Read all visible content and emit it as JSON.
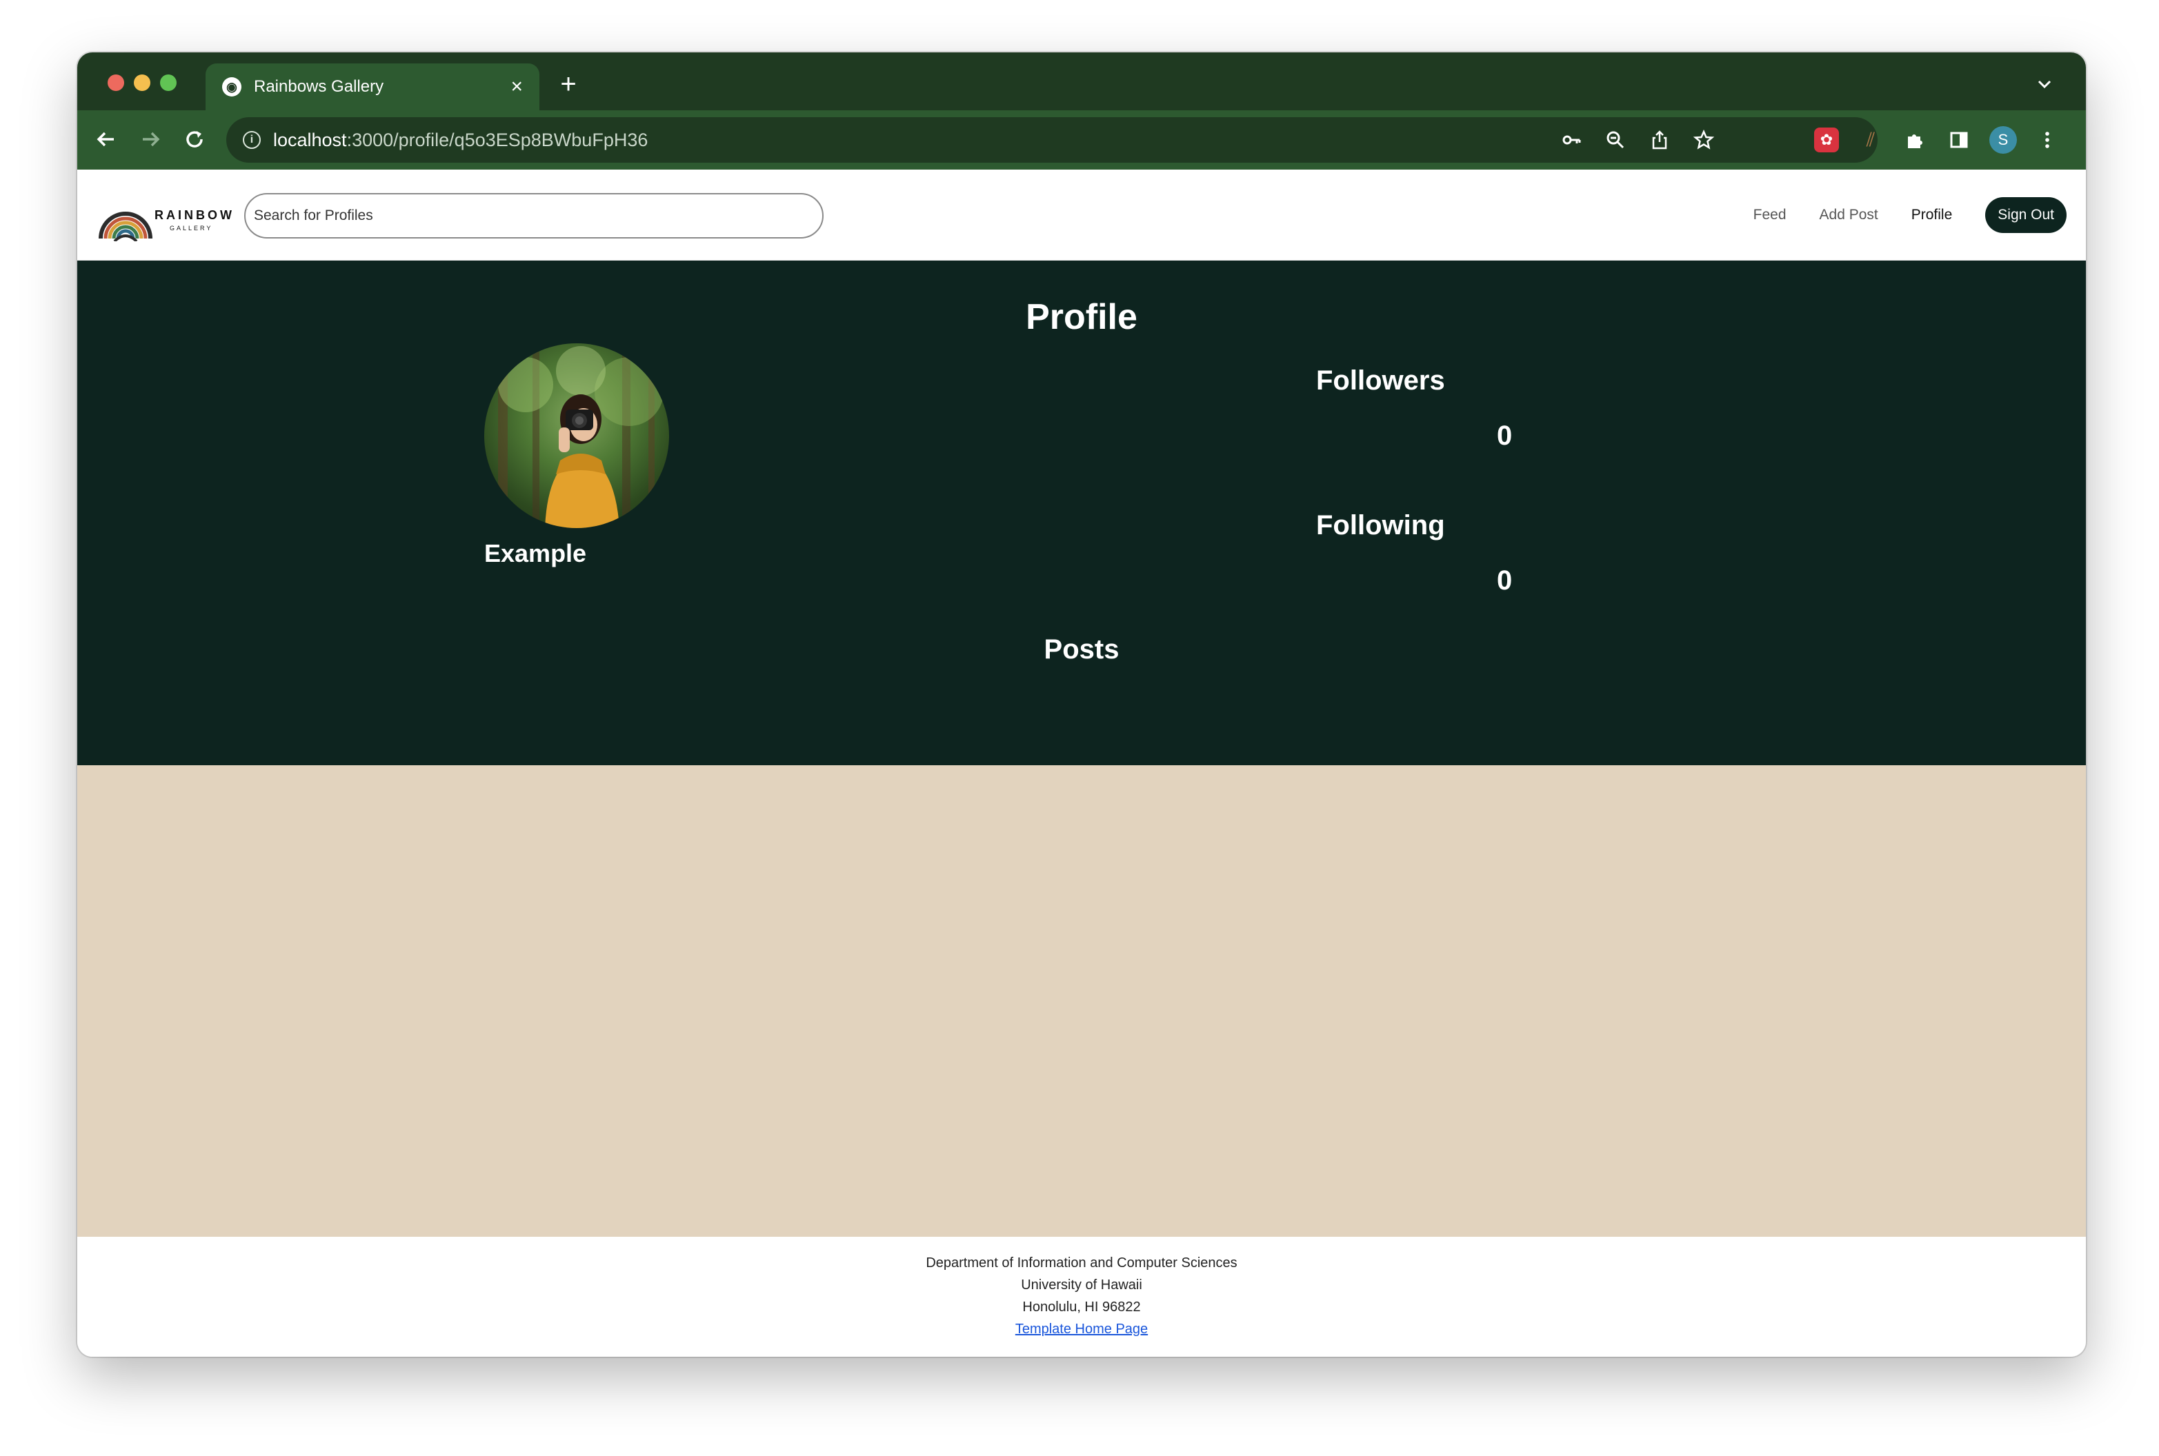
{
  "browser": {
    "tab_title": "Rainbows Gallery",
    "favicon": "camera-icon",
    "new_tab": "+",
    "url_host": "localhost",
    "url_path": ":3000/profile/q5o3ESp8BWbuFpH36",
    "avatar_initial": "S"
  },
  "navbar": {
    "logo_word": "RAINBOW",
    "logo_sub": "GALLERY",
    "search_placeholder": "Search for Profiles",
    "links": {
      "feed": "Feed",
      "add_post": "Add Post",
      "profile": "Profile"
    },
    "sign_out": "Sign Out"
  },
  "profile": {
    "title": "Profile",
    "username": "Example",
    "followers_label": "Followers",
    "followers_count": "0",
    "following_label": "Following",
    "following_count": "0",
    "posts_title": "Posts"
  },
  "footer": {
    "line1": "Department of Information and Computer Sciences",
    "line2": "University of Hawaii",
    "line3": "Honolulu, HI 96822",
    "link": "Template Home Page"
  },
  "colors": {
    "chrome_dark": "#1f3a21",
    "chrome_toolbar": "#2d5a30",
    "profile_bg": "#0d241f",
    "posts_bg": "#e2d3be",
    "link": "#1a56db"
  }
}
